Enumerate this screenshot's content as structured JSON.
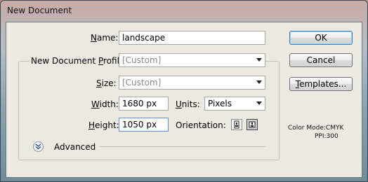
{
  "window": {
    "title": "New Document"
  },
  "form": {
    "name": {
      "label_pre": "",
      "label_u": "N",
      "label_post": "ame:",
      "value": "landscape"
    },
    "profile": {
      "label_pre": "New Document ",
      "label_u": "P",
      "label_post": "rofile:",
      "value": "[Custom]"
    },
    "size": {
      "label_pre": "",
      "label_u": "S",
      "label_post": "ize:",
      "value": "[Custom]"
    },
    "width": {
      "label_pre": "",
      "label_u": "W",
      "label_post": "idth:",
      "value": "1680 px"
    },
    "units": {
      "label_pre": "",
      "label_u": "U",
      "label_post": "nits:",
      "value": "Pixels"
    },
    "height": {
      "label_pre": "",
      "label_u": "H",
      "label_post": "eight:",
      "value": "1050 px"
    },
    "orientation": {
      "label": "Orientation:",
      "selected": "landscape"
    },
    "advanced": {
      "label": "Advanced"
    }
  },
  "buttons": {
    "ok": "OK",
    "cancel": "Cancel",
    "templates_u": "T",
    "templates_rest": "emplates..."
  },
  "info": {
    "color_mode": "Color Mode:CMYK",
    "ppi": "PPI:300"
  },
  "icons": {
    "portrait": "portrait-orientation-icon",
    "landscape": "landscape-orientation-icon",
    "advanced": "chevron-double-down-icon",
    "dropdown": "chevron-down-icon"
  }
}
